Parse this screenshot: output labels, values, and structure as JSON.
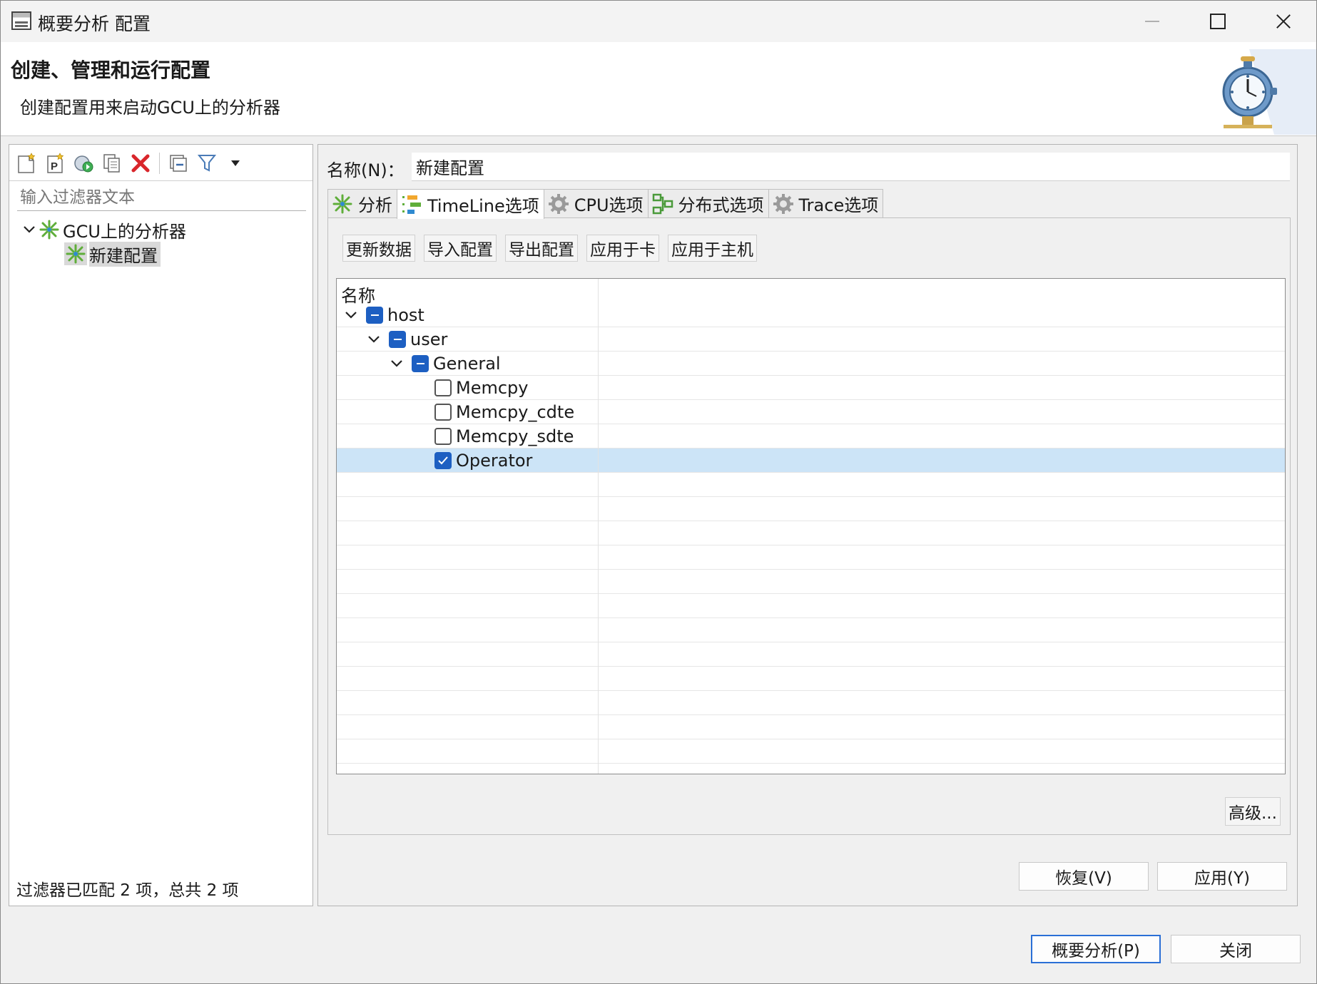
{
  "window": {
    "title": "概要分析 配置"
  },
  "banner": {
    "title": "创建、管理和运行配置",
    "subtitle": "创建配置用来启动GCU上的分析器"
  },
  "left": {
    "filter_placeholder": "输入过滤器文本",
    "tree": [
      {
        "label": "GCU上的分析器",
        "expanded": true
      },
      {
        "label": "新建配置",
        "selected": true
      }
    ],
    "status": "过滤器已匹配 2 项，总共 2 项"
  },
  "right": {
    "name_label": "名称(N)：",
    "name_value": "新建配置",
    "tabs": [
      {
        "label": "分析",
        "icon": "profiler-icon"
      },
      {
        "label": "TimeLine选项",
        "icon": "timeline-icon",
        "active": true
      },
      {
        "label": "CPU选项",
        "icon": "gear-icon"
      },
      {
        "label": "分布式选项",
        "icon": "distributed-icon"
      },
      {
        "label": "Trace选项",
        "icon": "gear-icon"
      }
    ],
    "actions": [
      "更新数据",
      "导入配置",
      "导出配置",
      "应用于卡",
      "应用于主机"
    ],
    "grid": {
      "header": "名称",
      "rows": [
        {
          "label": "host",
          "state": "partial",
          "expanded": true
        },
        {
          "label": "user",
          "state": "partial",
          "expanded": true
        },
        {
          "label": "General",
          "state": "partial",
          "expanded": true
        },
        {
          "label": "Memcpy",
          "state": "unchecked"
        },
        {
          "label": "Memcpy_cdte",
          "state": "unchecked"
        },
        {
          "label": "Memcpy_sdte",
          "state": "unchecked"
        },
        {
          "label": "Operator",
          "state": "checked",
          "selected": true
        }
      ]
    },
    "advanced_label": "高级...",
    "revert_label": "恢复(V)",
    "apply_label": "应用(Y)"
  },
  "footer": {
    "profile_label": "概要分析(P)",
    "close_label": "关闭"
  },
  "colors": {
    "accent": "#1d5fc2",
    "selection": "#cce4f7",
    "default_button_border": "#2a6fd6"
  }
}
